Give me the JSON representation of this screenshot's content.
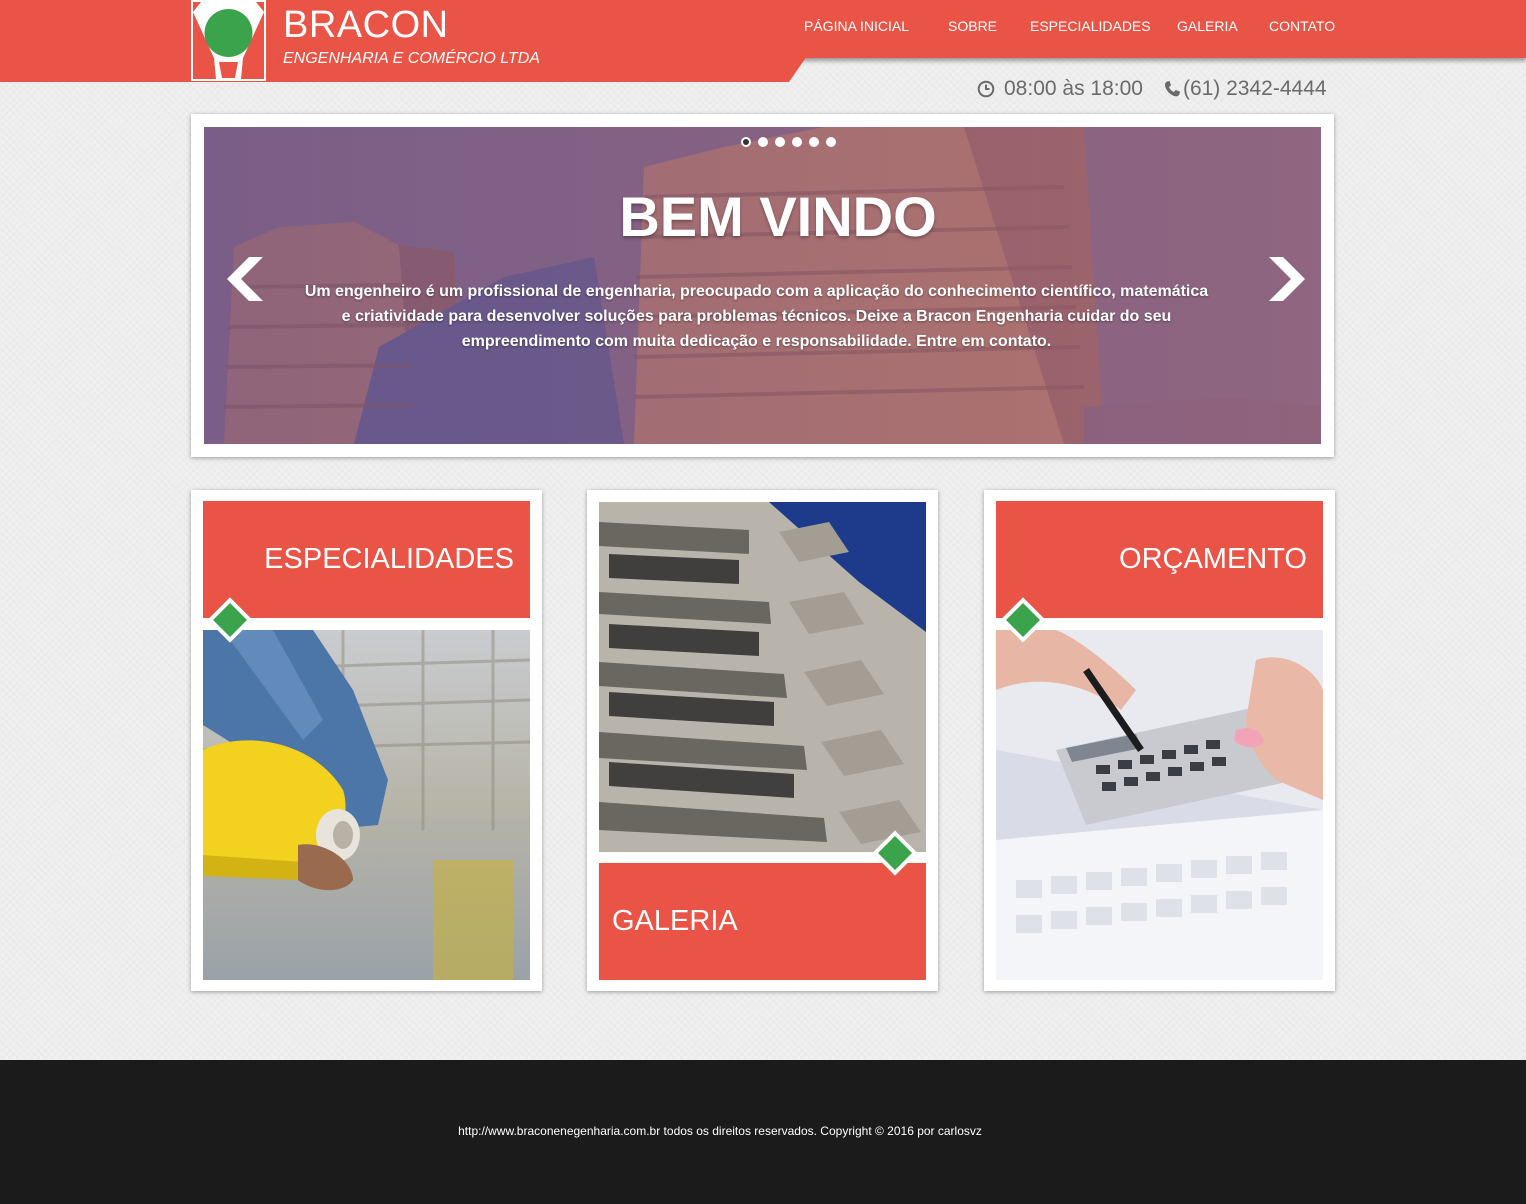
{
  "colors": {
    "brand_red": "#e95446",
    "accent_green": "#3aa34b",
    "footer_bg": "#1b1b1b",
    "page_bg": "#efefef"
  },
  "header": {
    "brand_name": "BRACON",
    "brand_subtitle": "ENGENHARIA E COMÉRCIO LTDA",
    "logo_icon": "green-circle-logo",
    "nav": [
      {
        "label": "PÁGINA INICIAL"
      },
      {
        "label": "SOBRE"
      },
      {
        "label": "ESPECIALIDADES"
      },
      {
        "label": "GALERIA"
      },
      {
        "label": "CONTATO"
      }
    ],
    "hours": "08:00 às 18:00",
    "hours_icon": "clock-icon",
    "phone": "(61) 2342-4444",
    "phone_icon": "phone-icon"
  },
  "slider": {
    "title": "BEM VINDO",
    "text": "Um engenheiro é um profissional de engenharia, preocupado com a aplicação do conhecimento científico, matemática e criatividade para desenvolver soluções para problemas técnicos. Deixe a Bracon Engenharia cuidar do seu empreendimento com muita dedicação e responsabilidade. Entre em contato.",
    "dots_count": 6,
    "active_dot": 1,
    "prev_icon": "chevron-left-icon",
    "next_icon": "chevron-right-icon"
  },
  "cards": [
    {
      "label": "ESPECIALIDADES",
      "image": "worker-with-yellow-helmet"
    },
    {
      "label": "GALERIA",
      "image": "building-facade-balconies"
    },
    {
      "label": "ORÇAMENTO",
      "image": "hands-with-calculator-and-pen"
    }
  ],
  "footer": {
    "text": "http://www.braconenegenharia.com.br todos os direitos reservados. Copyright © 2016 por carlosvz"
  }
}
